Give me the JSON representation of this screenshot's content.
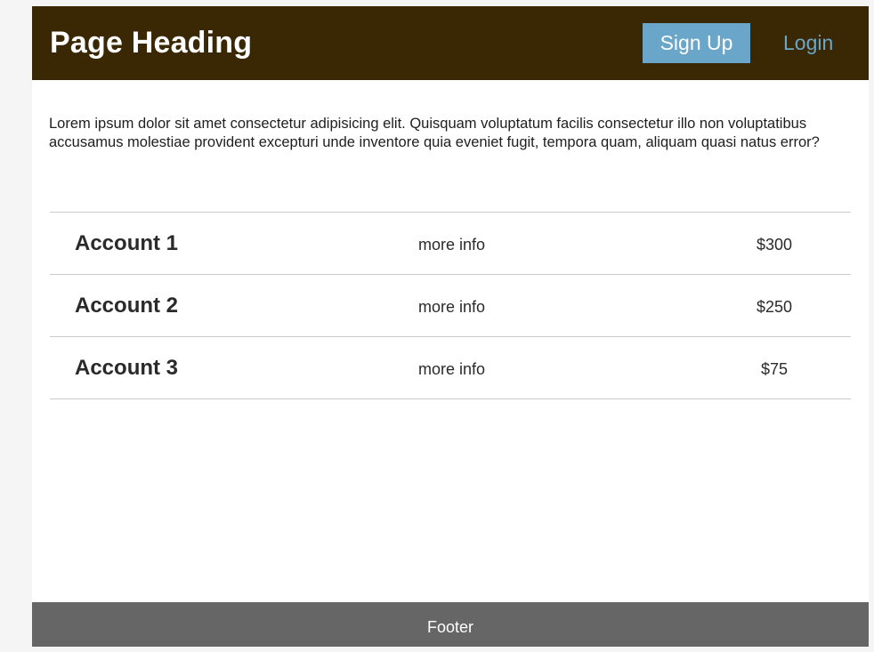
{
  "header": {
    "title": "Page Heading",
    "signup_label": "Sign Up",
    "login_label": "Login"
  },
  "intro": {
    "text": "Lorem ipsum dolor sit amet consectetur adipisicing elit. Quisquam voluptatum facilis consectetur illo non voluptatibus accusamus molestiae provident excepturi unde inventore quia eveniet fugit, tempora quam, aliquam quasi natus error?"
  },
  "accounts": [
    {
      "name": "Account 1",
      "info_label": "more info",
      "amount": "$300"
    },
    {
      "name": "Account 2",
      "info_label": "more info",
      "amount": "$250"
    },
    {
      "name": "Account 3",
      "info_label": "more info",
      "amount": "$75"
    }
  ],
  "footer": {
    "text": "Footer"
  },
  "colors": {
    "header_bg": "#3a2804",
    "accent": "#6aa6c9",
    "footer_bg": "#666666"
  }
}
